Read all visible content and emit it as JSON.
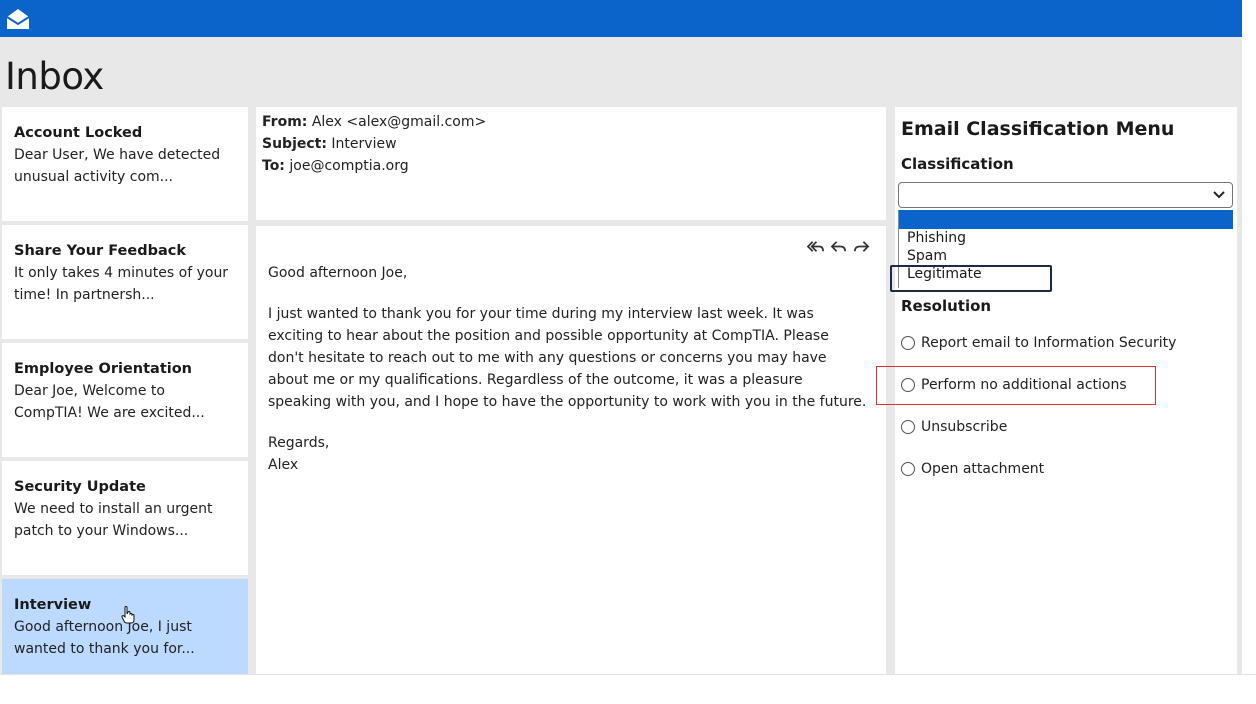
{
  "app": {
    "logo_icon": "envelope-open-icon",
    "brand_color": "#0b64c9",
    "title": "Inbox"
  },
  "inbox": {
    "items": [
      {
        "subject": "Account Locked",
        "preview": "Dear User, We have detected unusual activity com...",
        "selected": false
      },
      {
        "subject": "Share Your Feedback",
        "preview": "It only takes 4 minutes of your time! In partnersh...",
        "selected": false
      },
      {
        "subject": "Employee Orientation",
        "preview": "Dear Joe, Welcome to CompTIA! We are excited...",
        "selected": false
      },
      {
        "subject": "Security Update",
        "preview": "We need to install an urgent patch to your Windows...",
        "selected": false
      },
      {
        "subject": "Interview",
        "preview": "Good afternoon Joe, I just wanted to thank you for...",
        "selected": true
      }
    ],
    "selected_color": "#bcdaff"
  },
  "email": {
    "from_label": "From:",
    "from_value": "Alex <alex@gmail.com>",
    "subject_label": "Subject:",
    "subject_value": "Interview",
    "to_label": "To:",
    "to_value": "joe@comptia.org",
    "actions": [
      "reply-all-icon",
      "reply-icon",
      "forward-icon"
    ],
    "greeting": "Good afternoon Joe,",
    "paragraph": "I just wanted to thank you for your time during my interview last week. It was exciting to hear about the position and possible opportunity at CompTIA. Please don't hesitate to reach out to me with any questions or concerns you may have about me or my qualifications. Regardless of the outcome, it was a pleasure speaking with you, and I hope to have the opportunity to work with you in the future.",
    "closing": "Regards,",
    "signature": "Alex"
  },
  "menu": {
    "title": "Email Classification Menu",
    "classification_label": "Classification",
    "selected_value": "",
    "options": [
      "Phishing",
      "Spam",
      "Legitimate"
    ],
    "resolution_label": "Resolution",
    "resolutions": [
      "Report email to Information Security",
      "Perform no additional actions",
      "Unsubscribe",
      "Open attachment"
    ],
    "highlight_colors": {
      "legitimate_box": "#1c2a44",
      "resolution_box": "#d93030"
    }
  }
}
